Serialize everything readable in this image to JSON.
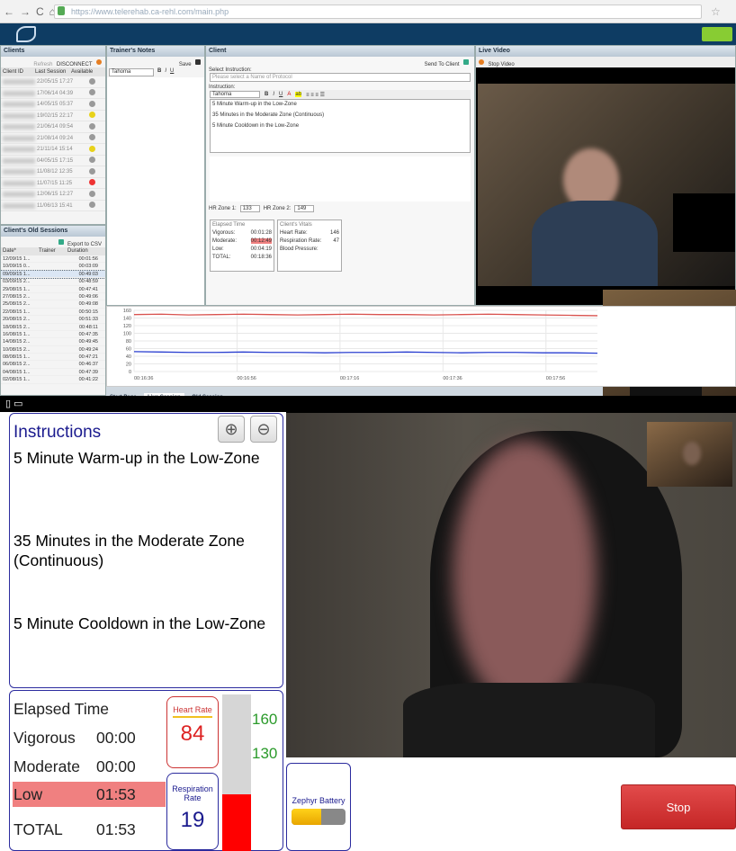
{
  "browser": {
    "url": "https://www.telerehab.ca-rehl.com/main.php"
  },
  "clients_panel": {
    "title": "Clients",
    "refresh_label": "Refresh",
    "disconnect_label": "DISCONNECT",
    "columns": [
      "Client ID",
      "Last Session",
      "Available"
    ],
    "rows": [
      {
        "last": "22/05/15 17:27",
        "status": "gray"
      },
      {
        "last": "17/06/14 04:39",
        "status": "gray"
      },
      {
        "last": "14/05/15 05:37",
        "status": "gray"
      },
      {
        "last": "19/02/15 22:17",
        "status": "yellow"
      },
      {
        "last": "21/06/14 09:54",
        "status": "gray"
      },
      {
        "last": "21/08/14 09:24",
        "status": "gray"
      },
      {
        "last": "21/11/14 15:14",
        "status": "yellow"
      },
      {
        "last": "04/05/15 17:15",
        "status": "gray"
      },
      {
        "last": "11/08/12 12:35",
        "status": "gray"
      },
      {
        "last": "11/07/15 11:25",
        "status": "red"
      },
      {
        "last": "12/06/15 12:27",
        "status": "gray"
      },
      {
        "last": "11/06/13 15:41",
        "status": "gray"
      }
    ]
  },
  "old_sessions": {
    "title": "Client's Old Sessions",
    "export_label": "Export to CSV",
    "columns": [
      "Date*",
      "Trainer",
      "Duration"
    ],
    "rows": [
      {
        "date": "12/09/15 1...",
        "dur": "00:01:56"
      },
      {
        "date": "10/09/15 0...",
        "dur": "00:03:09"
      },
      {
        "date": "09/09/15 1...",
        "dur": "00:49:03"
      },
      {
        "date": "03/09/15 2...",
        "dur": "00:48:59"
      },
      {
        "date": "29/08/15 1...",
        "dur": "00:47:41"
      },
      {
        "date": "27/08/15 2...",
        "dur": "00:49:06"
      },
      {
        "date": "25/08/15 2...",
        "dur": "00:49:08"
      },
      {
        "date": "22/08/15 1...",
        "dur": "00:50:15"
      },
      {
        "date": "20/08/15 2...",
        "dur": "00:51:33"
      },
      {
        "date": "18/08/15 2...",
        "dur": "00:48:11"
      },
      {
        "date": "16/08/15 1...",
        "dur": "00:47:35"
      },
      {
        "date": "14/08/15 2...",
        "dur": "00:49:45"
      },
      {
        "date": "10/08/15 2...",
        "dur": "00:49:24"
      },
      {
        "date": "08/08/15 1...",
        "dur": "00:47:21"
      },
      {
        "date": "06/08/15 2...",
        "dur": "00:46:37"
      },
      {
        "date": "04/08/15 1...",
        "dur": "00:47:39"
      },
      {
        "date": "02/08/15 1...",
        "dur": "00:41:22"
      }
    ]
  },
  "trainer_notes": {
    "title": "Trainer's Notes",
    "save_label": "Save",
    "font": "Tahoma"
  },
  "client_panel": {
    "title": "Client",
    "send_label": "Send To Client",
    "select_label": "Select Instruction:",
    "select_placeholder": "Please select a Name of Protocol",
    "instruction_label": "Instruction:",
    "font": "Tahoma",
    "lines": [
      "5 Minute Warm-up in the Low-Zone",
      "35 Minutes in the Moderate Zone (Continuous)",
      "5 Minute Cooldown in the Low-Zone"
    ],
    "hr_zone1_label": "HR Zone 1:",
    "hr_zone1": "133",
    "hr_zone2_label": "HR Zone 2:",
    "hr_zone2": "149",
    "elapsed_title": "Elapsed Time",
    "vigorous_label": "Vigorous:",
    "vigorous": "00:01:28",
    "moderate_label": "Moderate:",
    "moderate": "00:12:49",
    "low_label": "Low:",
    "low": "00:04:19",
    "total_label": "TOTAL:",
    "total": "00:18:36",
    "vitals_title": "Client's Vitals",
    "hr_label": "Heart Rate:",
    "hr": "146",
    "rr_label": "Respiration Rate:",
    "rr": "47",
    "bp_label": "Blood Pressure:"
  },
  "live_video": {
    "title": "Live Video",
    "stop_label": "Stop Video"
  },
  "chart_data": {
    "type": "line",
    "yticks": [
      "160",
      "140",
      "120",
      "100",
      "80",
      "60",
      "40",
      "20",
      "0"
    ],
    "ylim": [
      0,
      160
    ],
    "xticks": [
      "00:16:36",
      "00:16:56",
      "00:17:16",
      "00:17:36",
      "00:17:56"
    ],
    "grid": true,
    "series": [
      {
        "color": "#d9534f",
        "values": [
          149,
          150,
          148,
          149,
          150,
          149,
          148,
          149,
          150,
          149,
          149,
          148,
          149,
          150,
          149,
          148,
          147,
          146
        ]
      },
      {
        "color": "#2a3fd0",
        "values": [
          52,
          51,
          50,
          50,
          51,
          50,
          50,
          49,
          50,
          50,
          51,
          50,
          49,
          50,
          50,
          49,
          49,
          48
        ]
      }
    ]
  },
  "bottom_tabs": [
    "Start Page",
    "Live Session",
    "Old Session"
  ],
  "instructions": {
    "title": "Instructions",
    "lines": [
      "5 Minute Warm-up in the Low-Zone",
      "35 Minutes in the Moderate Zone (Continuous)",
      "5 Minute Cooldown in the Low-Zone"
    ]
  },
  "elapsed": {
    "title": "Elapsed Time",
    "vigorous_label": "Vigorous",
    "vigorous": "00:00",
    "moderate_label": "Moderate",
    "moderate": "00:00",
    "low_label": "Low",
    "low": "01:53",
    "total_label": "TOTAL",
    "total": "01:53",
    "highlight_color": "#f08080"
  },
  "vitals": {
    "hr_label": "Heart Rate",
    "hr": "84",
    "rr_label": "Respiration Rate",
    "rr": "19",
    "zone_high": "160",
    "zone_low": "130",
    "hr_level": 0.36
  },
  "battery": {
    "label": "Zephyr Battery",
    "level": 0.55
  },
  "stop_label": "Stop"
}
